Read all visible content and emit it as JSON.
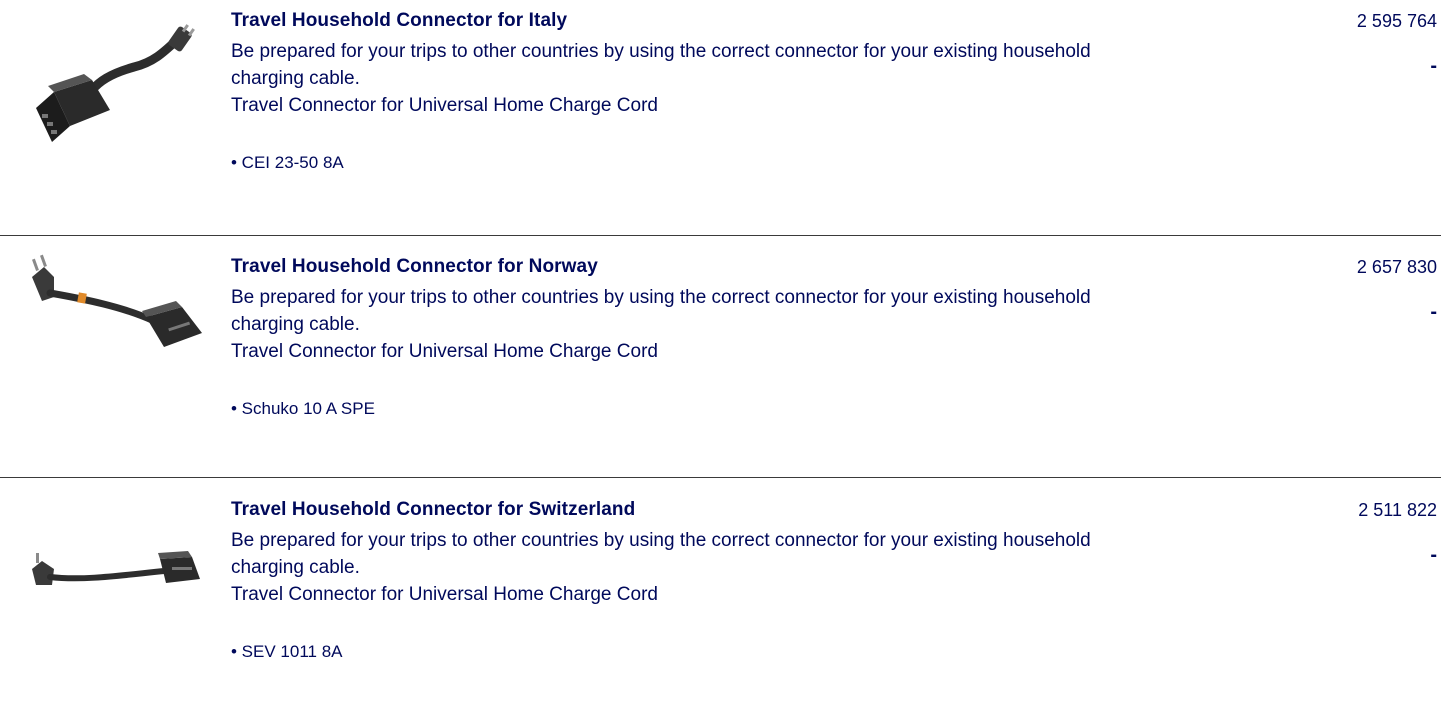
{
  "products": [
    {
      "title": "Travel Household Connector for Italy",
      "description": "Be prepared for your trips to other countries by using the correct connector for your existing household charging cable.",
      "subtitle": "Travel Connector for Universal Home Charge Cord",
      "spec": "• CEI 23-50 8A",
      "part_number": "2 595 764",
      "price": "-",
      "image_icon": "italy-connector-image"
    },
    {
      "title": "Travel Household Connector for Norway",
      "description": "Be prepared for your trips to other countries by using the correct connector for your existing household charging cable.",
      "subtitle": "Travel Connector for Universal Home Charge Cord",
      "spec": "• Schuko 10 A SPE",
      "part_number": "2 657 830",
      "price": "-",
      "image_icon": "norway-connector-image"
    },
    {
      "title": "Travel Household Connector for Switzerland",
      "description": "Be prepared for your trips to other countries by using the correct connector for your existing household charging cable.",
      "subtitle": "Travel Connector for Universal Home Charge Cord",
      "spec": "• SEV 1011 8A",
      "part_number": "2 511 822",
      "price": "-",
      "image_icon": "switzerland-connector-image"
    }
  ],
  "colors": {
    "text": "#00095b",
    "divider": "#3a3a3a",
    "background": "#ffffff"
  }
}
